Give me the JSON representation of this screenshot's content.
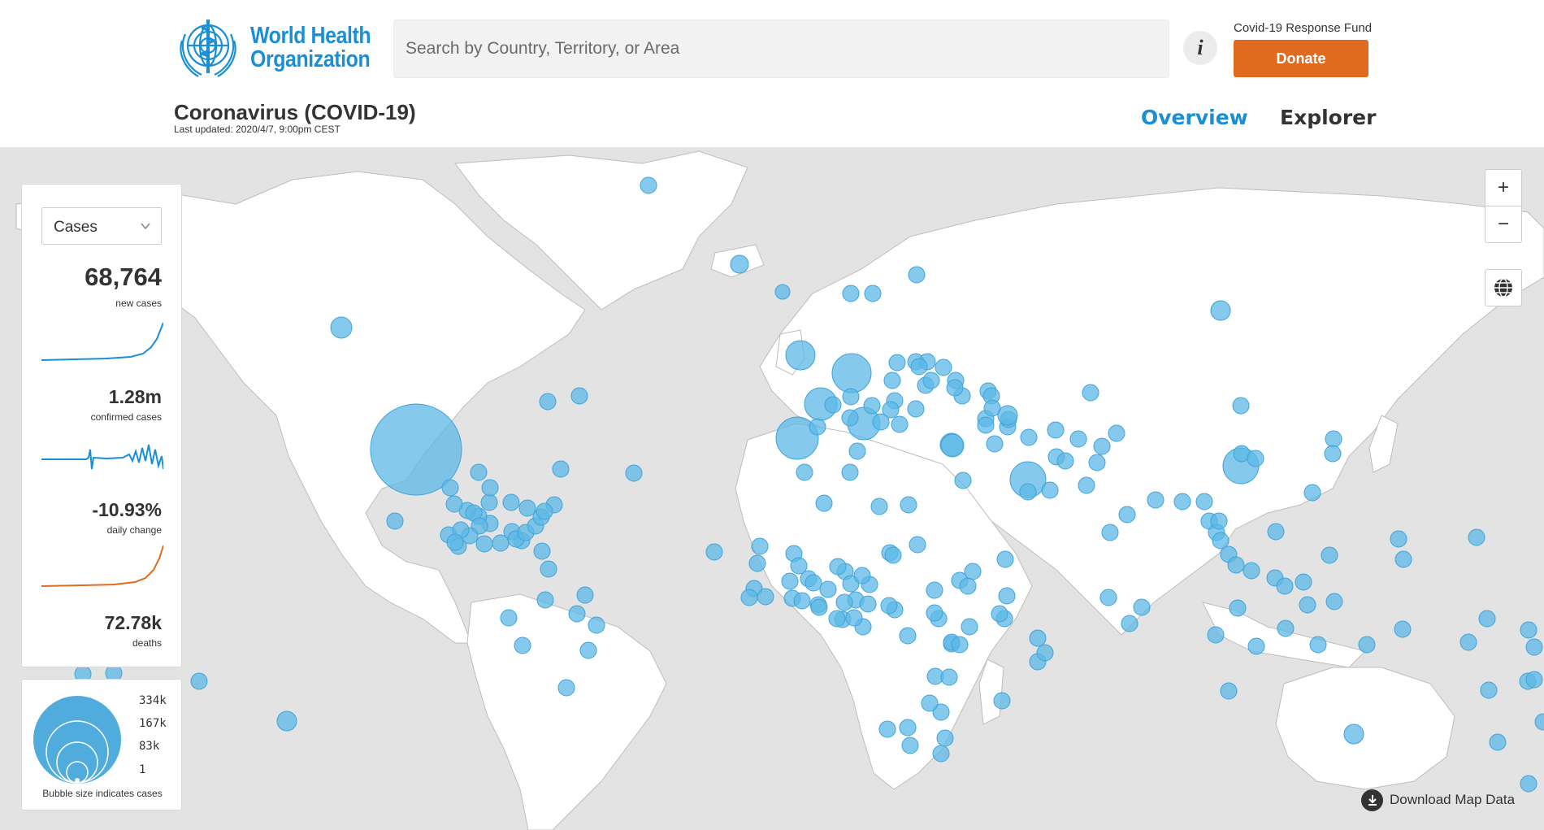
{
  "header": {
    "logo_line1": "World Health",
    "logo_line2": "Organization",
    "search_placeholder": "Search by Country, Territory, or Area",
    "info_label": "i",
    "fund_label": "Covid-19 Response Fund",
    "donate_label": "Donate",
    "title": "Coronavirus (COVID-19)",
    "last_updated": "Last updated: 2020/4/7, 9:00pm CEST",
    "tabs": [
      {
        "label": "Overview",
        "active": true
      },
      {
        "label": "Explorer",
        "active": false
      }
    ]
  },
  "stats": {
    "metric_selected": "Cases",
    "items": [
      {
        "value": "68,764",
        "label": "new cases",
        "spark_color": "#1a8fd6"
      },
      {
        "value": "1.28m",
        "label": "confirmed cases",
        "spark_color": "#1a8fd6"
      },
      {
        "value": "-10.93%",
        "label": "daily change",
        "spark_color": "#1a8fd6"
      },
      {
        "value": "72.78k",
        "label": "deaths",
        "spark_color": "#e06b1f"
      }
    ]
  },
  "legend": {
    "values": [
      "334k",
      "167k",
      "83k",
      "1"
    ],
    "caption": "Bubble size indicates cases"
  },
  "map_controls": {
    "zoom_in": "+",
    "zoom_out": "−",
    "download_label": "Download Map Data"
  },
  "colors": {
    "brand_blue": "#1a8fd6",
    "donate_orange": "#e06b1f",
    "bubble_fill": "#5cb8e6",
    "map_ocean": "#e3e3e3",
    "map_land": "#ffffff"
  }
}
